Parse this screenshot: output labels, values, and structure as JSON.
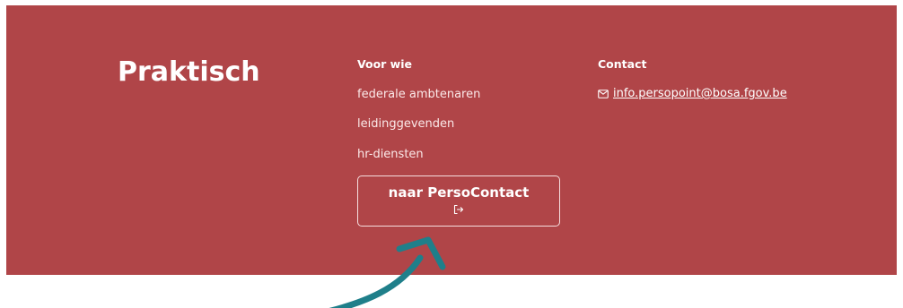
{
  "section": {
    "heading": "Praktisch"
  },
  "voor_wie": {
    "title": "Voor wie",
    "links": [
      "federale ambtenaren",
      "leidinggevenden",
      "hr-diensten"
    ]
  },
  "contact": {
    "title": "Contact",
    "email": "info.persopoint@bosa.fgov.be",
    "icon": "mail-icon"
  },
  "cta": {
    "label": "naar PersoContact",
    "icon": "external-link-icon"
  },
  "annotation": {
    "icon": "curved-arrow-icon"
  },
  "colors": {
    "panel": "#b04548",
    "text": "#ffffff",
    "arrow": "#1f7f8a",
    "page_background": "#ffffff"
  }
}
